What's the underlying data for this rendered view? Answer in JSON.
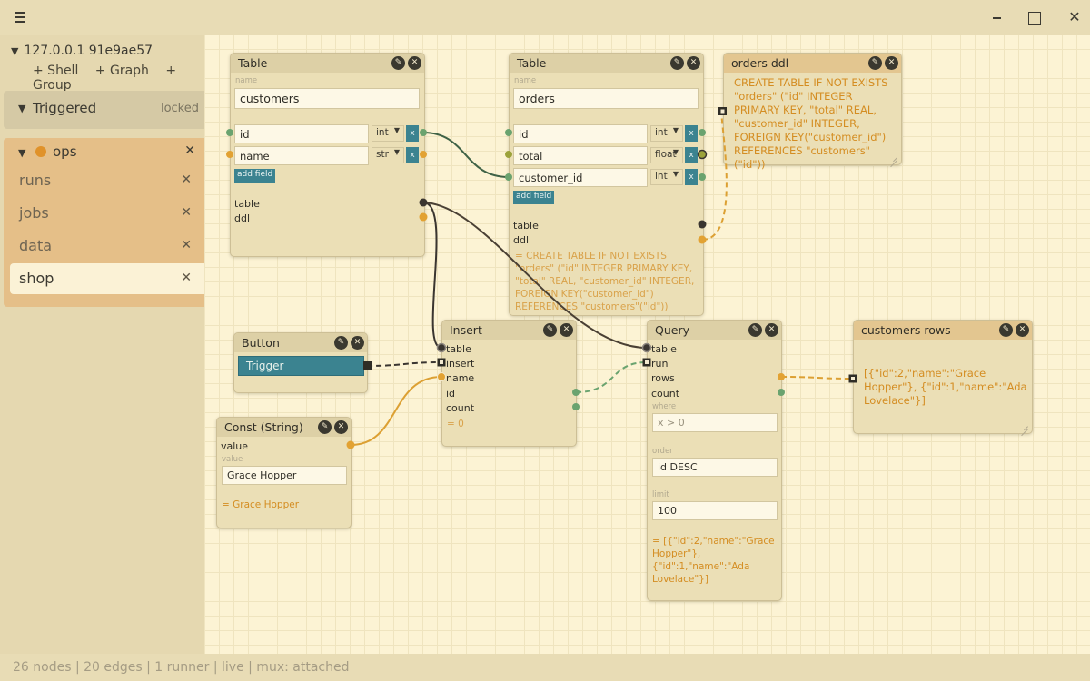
{
  "sidebar": {
    "host": "127.0.0.1 91e9ae57",
    "actions": [
      "+ Shell",
      "+ Graph",
      "+ Group"
    ],
    "triggered": {
      "label": "Triggered",
      "status": "locked"
    },
    "ops": {
      "label": "ops",
      "tabs": [
        {
          "label": "runs"
        },
        {
          "label": "jobs"
        },
        {
          "label": "data"
        },
        {
          "label": "shop",
          "active": true
        }
      ]
    }
  },
  "status_bar": "26 nodes | 20 edges | 1 runner | live | mux: attached",
  "colors": {
    "teal": "#3b8390",
    "orange_port": "#e2a233",
    "green_port": "#6aa36f",
    "dark_port": "#3a3530",
    "canvas": "#fcf3d4"
  },
  "nodes": {
    "table_customers": {
      "title": "Table",
      "name_label": "name",
      "name": "customers",
      "fields": [
        {
          "name": "id",
          "type": "int"
        },
        {
          "name": "name",
          "type": "str"
        }
      ],
      "add_field": "add field",
      "out_table": "table",
      "out_ddl": "ddl"
    },
    "table_orders": {
      "title": "Table",
      "name_label": "name",
      "name": "orders",
      "fields": [
        {
          "name": "id",
          "type": "int"
        },
        {
          "name": "total",
          "type": "float"
        },
        {
          "name": "customer_id",
          "type": "int"
        }
      ],
      "add_field": "add field",
      "out_table": "table",
      "out_ddl": "ddl",
      "ddl_preview": "= CREATE TABLE IF NOT EXISTS \"orders\" (\"id\" INTEGER PRIMARY KEY, \"total\" REAL, \"customer_id\" INTEGER, FOREIGN KEY(\"customer_id\") REFERENCES \"customers\"(\"id\"))"
    },
    "orders_ddl": {
      "title": "orders ddl",
      "text": "CREATE TABLE IF NOT EXISTS \"orders\" (\"id\" INTEGER PRIMARY KEY, \"total\" REAL, \"customer_id\" INTEGER, FOREIGN KEY(\"customer_id\") REFERENCES \"customers\"(\"id\"))"
    },
    "button": {
      "title": "Button",
      "label": "Trigger"
    },
    "const": {
      "title": "Const (String)",
      "port": "value",
      "value_label": "value",
      "value": "Grace Hopper",
      "output": "= Grace Hopper"
    },
    "insert": {
      "title": "Insert",
      "ports": [
        "table",
        "insert",
        "name",
        "id",
        "count"
      ],
      "output": "= 0"
    },
    "query": {
      "title": "Query",
      "ports": [
        "table",
        "run",
        "rows",
        "count"
      ],
      "where_label": "where",
      "where_placeholder": "x > 0",
      "order_label": "order",
      "order": "id DESC",
      "limit_label": "limit",
      "limit": "100",
      "output": "= [{\"id\":2,\"name\":\"Grace Hopper\"}, {\"id\":1,\"name\":\"Ada Lovelace\"}]"
    },
    "customers_rows": {
      "title": "customers rows",
      "text": "[{\"id\":2,\"name\":\"Grace Hopper\"}, {\"id\":1,\"name\":\"Ada Lovelace\"}]"
    }
  }
}
